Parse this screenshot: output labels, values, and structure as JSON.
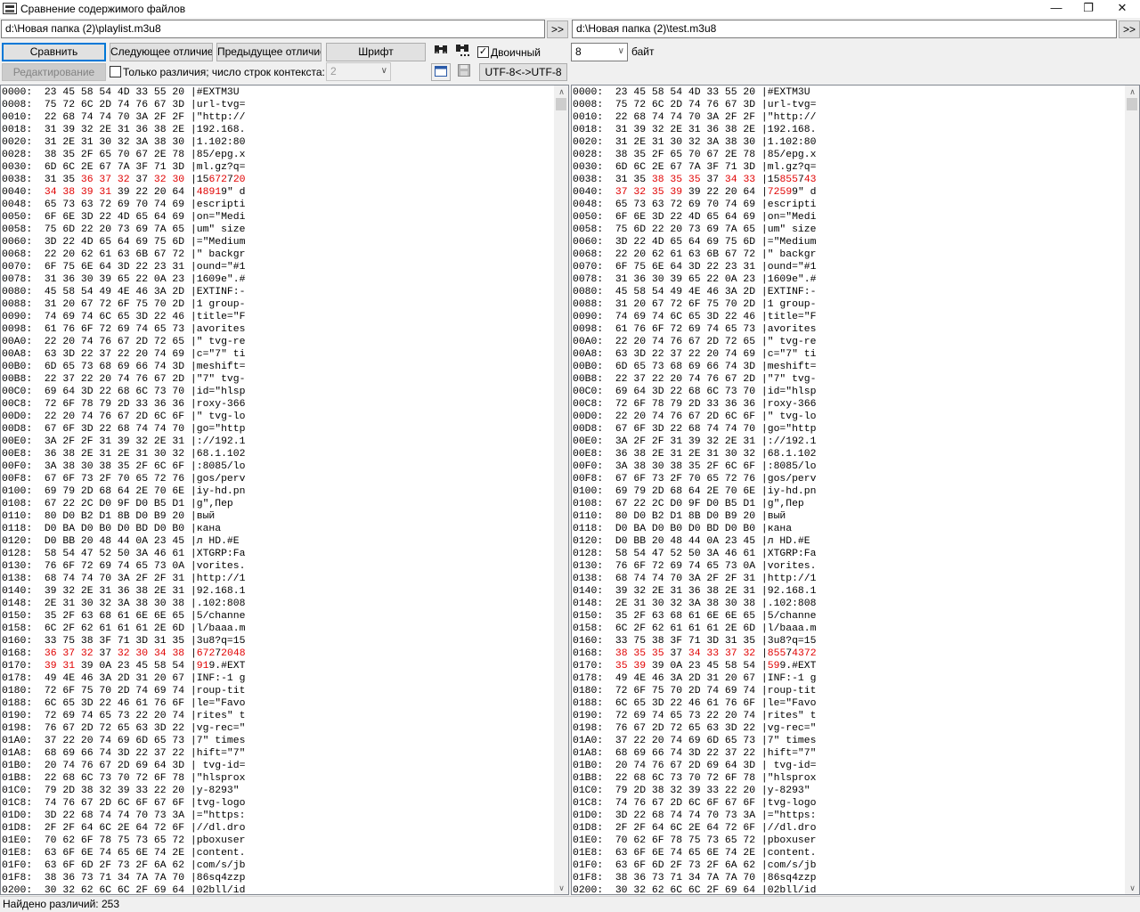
{
  "window": {
    "title": "Сравнение содержимого файлов"
  },
  "left_path": "d:\\Новая папка (2)\\playlist.m3u8",
  "right_path": "d:\\Новая папка (2)\\test.m3u8",
  "browse_label": ">>",
  "toolbar": {
    "compare": "Сравнить",
    "next_diff": "Следующее отличие",
    "prev_diff": "Предыдущее отличие",
    "font": "Шрифт",
    "binary_label": "Двоичный",
    "bytes_value": "8",
    "bytes_label": "байт",
    "editing": "Редактирование",
    "only_diffs_label": "Только различия; число строк контекста:",
    "context_value": "2",
    "encoding": "UTF-8<->UTF-8"
  },
  "colors": {
    "diff": "#e00000",
    "accent": "#0078d7"
  },
  "icons": [
    "find-icon",
    "find-next-icon",
    "window-icon",
    "save-icon"
  ],
  "status": {
    "text": "Найдено различий: 253"
  },
  "left_lines": [
    "0000: 23 45 58 54 4D 33 55 20 |#EXTM3U ",
    "0008: 75 72 6C 2D 74 76 67 3D |url-tvg=",
    "0010: 22 68 74 74 70 3A 2F 2F |\"http://",
    "0018: 31 39 32 2E 31 36 38 2E |192.168.",
    "0020: 31 2E 31 30 32 3A 38 30 |1.102:80",
    "0028: 38 35 2F 65 70 67 2E 78 |85/epg.x",
    "0030: 6D 6C 2E 67 7A 3F 71 3D |ml.gz?q=",
    "0038: 31 35 36 37 32 37 32 30 |15672720",
    "0040: 34 38 39 31 39 22 20 64 |48919\" d",
    "0048: 65 73 63 72 69 70 74 69 |escripti",
    "0050: 6F 6E 3D 22 4D 65 64 69 |on=\"Medi",
    "0058: 75 6D 22 20 73 69 7A 65 |um\" size",
    "0060: 3D 22 4D 65 64 69 75 6D |=\"Medium",
    "0068: 22 20 62 61 63 6B 67 72 |\" backgr",
    "0070: 6F 75 6E 64 3D 22 23 31 |ound=\"#1",
    "0078: 31 36 30 39 65 22 0A 23 |1609e\".#",
    "0080: 45 58 54 49 4E 46 3A 2D |EXTINF:-",
    "0088: 31 20 67 72 6F 75 70 2D |1 group-",
    "0090: 74 69 74 6C 65 3D 22 46 |title=\"F",
    "0098: 61 76 6F 72 69 74 65 73 |avorites",
    "00A0: 22 20 74 76 67 2D 72 65 |\" tvg-re",
    "00A8: 63 3D 22 37 22 20 74 69 |c=\"7\" ti",
    "00B0: 6D 65 73 68 69 66 74 3D |meshift=",
    "00B8: 22 37 22 20 74 76 67 2D |\"7\" tvg-",
    "00C0: 69 64 3D 22 68 6C 73 70 |id=\"hlsp",
    "00C8: 72 6F 78 79 2D 33 36 36 |roxy-366",
    "00D0: 22 20 74 76 67 2D 6C 6F |\" tvg-lo",
    "00D8: 67 6F 3D 22 68 74 74 70 |go=\"http",
    "00E0: 3A 2F 2F 31 39 32 2E 31 |://192.1",
    "00E8: 36 38 2E 31 2E 31 30 32 |68.1.102",
    "00F0: 3A 38 30 38 35 2F 6C 6F |:8085/lo",
    "00F8: 67 6F 73 2F 70 65 72 76 |gos/perv",
    "0100: 69 79 2D 68 64 2E 70 6E |iy-hd.pn",
    "0108: 67 22 2C D0 9F D0 B5 D1 |g\",Пер",
    "0110: 80 D0 B2 D1 8B D0 B9 20 |вый ",
    "0118: D0 BA D0 B0 D0 BD D0 B0 |кана",
    "0120: D0 BB 20 48 44 0A 23 45 |л HD.#E",
    "0128: 58 54 47 52 50 3A 46 61 |XTGRP:Fa",
    "0130: 76 6F 72 69 74 65 73 0A |vorites.",
    "0138: 68 74 74 70 3A 2F 2F 31 |http://1",
    "0140: 39 32 2E 31 36 38 2E 31 |92.168.1",
    "0148: 2E 31 30 32 3A 38 30 38 |.102:808",
    "0150: 35 2F 63 68 61 6E 6E 65 |5/channe",
    "0158: 6C 2F 62 61 61 61 2E 6D |l/baaa.m",
    "0160: 33 75 38 3F 71 3D 31 35 |3u8?q=15",
    "0168: 36 37 32 37 32 30 34 38 |67272048",
    "0170: 39 31 39 0A 23 45 58 54 |919.#EXT",
    "0178: 49 4E 46 3A 2D 31 20 67 |INF:-1 g",
    "0180: 72 6F 75 70 2D 74 69 74 |roup-tit",
    "0188: 6C 65 3D 22 46 61 76 6F |le=\"Favo",
    "0190: 72 69 74 65 73 22 20 74 |rites\" t",
    "0198: 76 67 2D 72 65 63 3D 22 |vg-rec=\"",
    "01A0: 37 22 20 74 69 6D 65 73 |7\" times",
    "01A8: 68 69 66 74 3D 22 37 22 |hift=\"7\"",
    "01B0: 20 74 76 67 2D 69 64 3D | tvg-id=",
    "01B8: 22 68 6C 73 70 72 6F 78 |\"hlsprox",
    "01C0: 79 2D 38 32 39 33 22 20 |y-8293\" ",
    "01C8: 74 76 67 2D 6C 6F 67 6F |tvg-logo",
    "01D0: 3D 22 68 74 74 70 73 3A |=\"https:",
    "01D8: 2F 2F 64 6C 2E 64 72 6F |//dl.dro",
    "01E0: 70 62 6F 78 75 73 65 72 |pboxuser",
    "01E8: 63 6F 6E 74 65 6E 74 2E |content.",
    "01F0: 63 6F 6D 2F 73 2F 6A 62 |com/s/jb",
    "01F8: 38 36 73 71 34 7A 7A 70 |86sq4zzp",
    "0200: 30 32 62 6C 6C 2F 69 64 |02bll/id"
  ],
  "right_lines": [
    "0000: 23 45 58 54 4D 33 55 20 |#EXTM3U ",
    "0008: 75 72 6C 2D 74 76 67 3D |url-tvg=",
    "0010: 22 68 74 74 70 3A 2F 2F |\"http://",
    "0018: 31 39 32 2E 31 36 38 2E |192.168.",
    "0020: 31 2E 31 30 32 3A 38 30 |1.102:80",
    "0028: 38 35 2F 65 70 67 2E 78 |85/epg.x",
    "0030: 6D 6C 2E 67 7A 3F 71 3D |ml.gz?q=",
    "0038: 31 35 38 35 35 37 34 33 |15855743",
    "0040: 37 32 35 39 39 22 20 64 |72599\" d",
    "0048: 65 73 63 72 69 70 74 69 |escripti",
    "0050: 6F 6E 3D 22 4D 65 64 69 |on=\"Medi",
    "0058: 75 6D 22 20 73 69 7A 65 |um\" size",
    "0060: 3D 22 4D 65 64 69 75 6D |=\"Medium",
    "0068: 22 20 62 61 63 6B 67 72 |\" backgr",
    "0070: 6F 75 6E 64 3D 22 23 31 |ound=\"#1",
    "0078: 31 36 30 39 65 22 0A 23 |1609e\".#",
    "0080: 45 58 54 49 4E 46 3A 2D |EXTINF:-",
    "0088: 31 20 67 72 6F 75 70 2D |1 group-",
    "0090: 74 69 74 6C 65 3D 22 46 |title=\"F",
    "0098: 61 76 6F 72 69 74 65 73 |avorites",
    "00A0: 22 20 74 76 67 2D 72 65 |\" tvg-re",
    "00A8: 63 3D 22 37 22 20 74 69 |c=\"7\" ti",
    "00B0: 6D 65 73 68 69 66 74 3D |meshift=",
    "00B8: 22 37 22 20 74 76 67 2D |\"7\" tvg-",
    "00C0: 69 64 3D 22 68 6C 73 70 |id=\"hlsp",
    "00C8: 72 6F 78 79 2D 33 36 36 |roxy-366",
    "00D0: 22 20 74 76 67 2D 6C 6F |\" tvg-lo",
    "00D8: 67 6F 3D 22 68 74 74 70 |go=\"http",
    "00E0: 3A 2F 2F 31 39 32 2E 31 |://192.1",
    "00E8: 36 38 2E 31 2E 31 30 32 |68.1.102",
    "00F0: 3A 38 30 38 35 2F 6C 6F |:8085/lo",
    "00F8: 67 6F 73 2F 70 65 72 76 |gos/perv",
    "0100: 69 79 2D 68 64 2E 70 6E |iy-hd.pn",
    "0108: 67 22 2C D0 9F D0 B5 D1 |g\",Пер",
    "0110: 80 D0 B2 D1 8B D0 B9 20 |вый ",
    "0118: D0 BA D0 B0 D0 BD D0 B0 |кана",
    "0120: D0 BB 20 48 44 0A 23 45 |л HD.#E",
    "0128: 58 54 47 52 50 3A 46 61 |XTGRP:Fa",
    "0130: 76 6F 72 69 74 65 73 0A |vorites.",
    "0138: 68 74 74 70 3A 2F 2F 31 |http://1",
    "0140: 39 32 2E 31 36 38 2E 31 |92.168.1",
    "0148: 2E 31 30 32 3A 38 30 38 |.102:808",
    "0150: 35 2F 63 68 61 6E 6E 65 |5/channe",
    "0158: 6C 2F 62 61 61 61 2E 6D |l/baaa.m",
    "0160: 33 75 38 3F 71 3D 31 35 |3u8?q=15",
    "0168: 38 35 35 37 34 33 37 32 |85574372",
    "0170: 35 39 39 0A 23 45 58 54 |599.#EXT",
    "0178: 49 4E 46 3A 2D 31 20 67 |INF:-1 g",
    "0180: 72 6F 75 70 2D 74 69 74 |roup-tit",
    "0188: 6C 65 3D 22 46 61 76 6F |le=\"Favo",
    "0190: 72 69 74 65 73 22 20 74 |rites\" t",
    "0198: 76 67 2D 72 65 63 3D 22 |vg-rec=\"",
    "01A0: 37 22 20 74 69 6D 65 73 |7\" times",
    "01A8: 68 69 66 74 3D 22 37 22 |hift=\"7\"",
    "01B0: 20 74 76 67 2D 69 64 3D | tvg-id=",
    "01B8: 22 68 6C 73 70 72 6F 78 |\"hlsprox",
    "01C0: 79 2D 38 32 39 33 22 20 |y-8293\" ",
    "01C8: 74 76 67 2D 6C 6F 67 6F |tvg-logo",
    "01D0: 3D 22 68 74 74 70 73 3A |=\"https:",
    "01D8: 2F 2F 64 6C 2E 64 72 6F |//dl.dro",
    "01E0: 70 62 6F 78 75 73 65 72 |pboxuser",
    "01E8: 63 6F 6E 74 65 6E 74 2E |content.",
    "01F0: 63 6F 6D 2F 73 2F 6A 62 |com/s/jb",
    "01F8: 38 36 73 71 34 7A 7A 70 |86sq4zzp",
    "0200: 30 32 62 6C 6C 2F 69 64 |02bll/id"
  ]
}
